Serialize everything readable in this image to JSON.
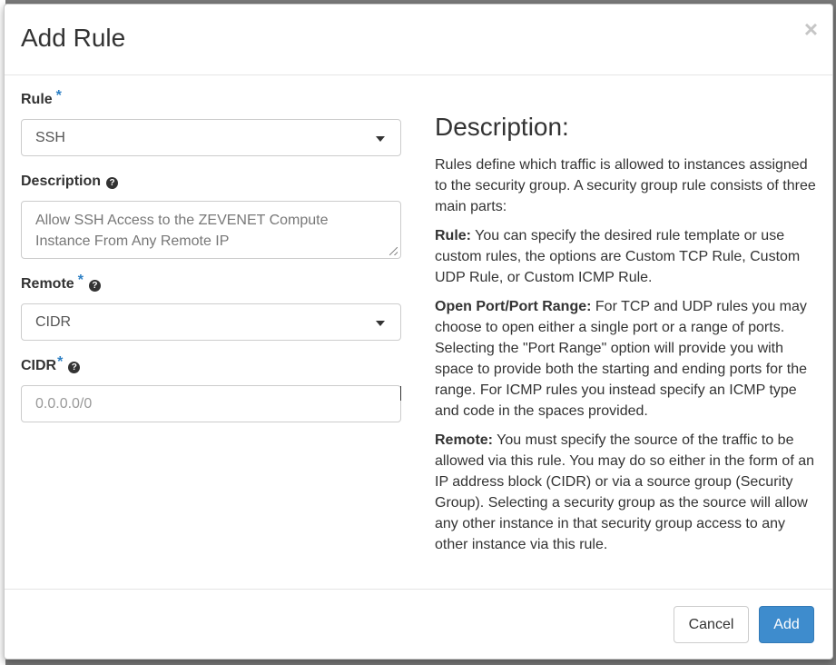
{
  "modal": {
    "title": "Add Rule",
    "close_glyph": "×"
  },
  "form": {
    "rule": {
      "label": "Rule",
      "required_mark": "*",
      "value": "SSH"
    },
    "description": {
      "label": "Description",
      "help_glyph": "?",
      "value": "Allow SSH Access to the ZEVENET Compute Instance From Any Remote IP"
    },
    "remote": {
      "label": "Remote",
      "required_mark": "*",
      "help_glyph": "?",
      "value": "CIDR"
    },
    "cidr": {
      "label": "CIDR",
      "required_mark": "*",
      "help_glyph": "?",
      "placeholder": "0.0.0.0/0"
    }
  },
  "help": {
    "title": "Description:",
    "intro": "Rules define which traffic is allowed to instances assigned to the security group. A security group rule consists of three main parts:",
    "rule_heading": "Rule:",
    "rule_text": "You can specify the desired rule template or use custom rules, the options are Custom TCP Rule, Custom UDP Rule, or Custom ICMP Rule.",
    "port_heading": "Open Port/Port Range:",
    "port_text": "For TCP and UDP rules you may choose to open either a single port or a range of ports. Selecting the \"Port Range\" option will provide you with space to provide both the starting and ending ports for the range. For ICMP rules you instead specify an ICMP type and code in the spaces provided.",
    "remote_heading": "Remote:",
    "remote_text": "You must specify the source of the traffic to be allowed via this rule. You may do so either in the form of an IP address block (CIDR) or via a source group (Security Group). Selecting a security group as the source will allow any other instance in that security group access to any other instance via this rule."
  },
  "footer": {
    "cancel_label": "Cancel",
    "add_label": "Add"
  },
  "colors": {
    "primary": "#3e8ccd",
    "required": "#2d7fc4"
  }
}
